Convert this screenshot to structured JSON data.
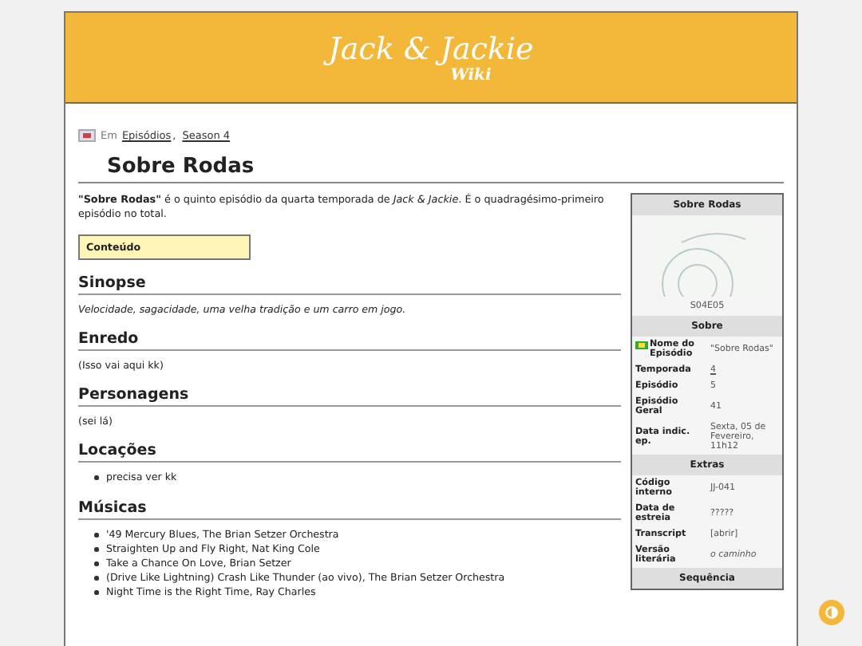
{
  "header": {
    "logo_main": "Jack & Jackie",
    "logo_sub": "Wiki"
  },
  "breadcrumb": {
    "prefix": "Em",
    "separator": ",",
    "links": [
      "Episódios",
      "Season 4"
    ]
  },
  "title": "Sobre Rodas",
  "intro": "**\"Sobre Rodas\"** é o quinto episódio da quarta temporada de *Jack & Jackie*. É o quadragésimo-primeiro episódio no total.",
  "toc": {
    "label": "Conteúdo"
  },
  "sections": [
    {
      "heading": "Sinopse",
      "kind": "italic",
      "text": "Velocidade, sagacidade, uma velha tradição e um carro em jogo."
    },
    {
      "heading": "Enredo",
      "kind": "text",
      "text": "(Isso vai aqui kk)"
    },
    {
      "heading": "Personagens",
      "kind": "text",
      "text": "(sei lá)"
    },
    {
      "heading": "Locações",
      "kind": "list",
      "items": [
        "precisa ver kk"
      ]
    },
    {
      "heading": "Músicas",
      "kind": "list",
      "items": [
        "'49 Mercury Blues, The Brian Setzer Orchestra",
        "Straighten Up and Fly Right, Nat King Cole",
        "Take a Chance On Love, Brian Setzer",
        "(Drive Like Lightning) Crash Like Thunder (ao vivo), The Brian Setzer Orchestra",
        "Night Time is the Right Time, Ray Charles"
      ]
    }
  ],
  "infobox": {
    "title": "Sobre Rodas",
    "caption": "S04E05",
    "rows": [
      {
        "kind": "heading",
        "label": "Sobre"
      },
      {
        "kind": "flag_row",
        "label": "Nome do Episódio",
        "value": "\"Sobre Rodas\""
      },
      {
        "kind": "link_row",
        "label": "Temporada",
        "value": "4"
      },
      {
        "kind": "row",
        "label": "Episódio",
        "value": "5"
      },
      {
        "kind": "row",
        "label": "Episódio Geral",
        "value": "41"
      },
      {
        "kind": "row",
        "label": "Data indic. ep.",
        "value": "Sexta, 05 de Fevereiro, 11h12"
      },
      {
        "kind": "heading",
        "label": "Extras"
      },
      {
        "kind": "row",
        "label": "Código interno",
        "value": "JJ-041"
      },
      {
        "kind": "row",
        "label": "Data de estreia",
        "value": "?????"
      },
      {
        "kind": "row",
        "label": "Transcript",
        "value": "[abrir]"
      },
      {
        "kind": "italic_row",
        "label": "Versão literária",
        "value": "o caminho"
      },
      {
        "kind": "heading",
        "label": "Sequência"
      }
    ]
  }
}
